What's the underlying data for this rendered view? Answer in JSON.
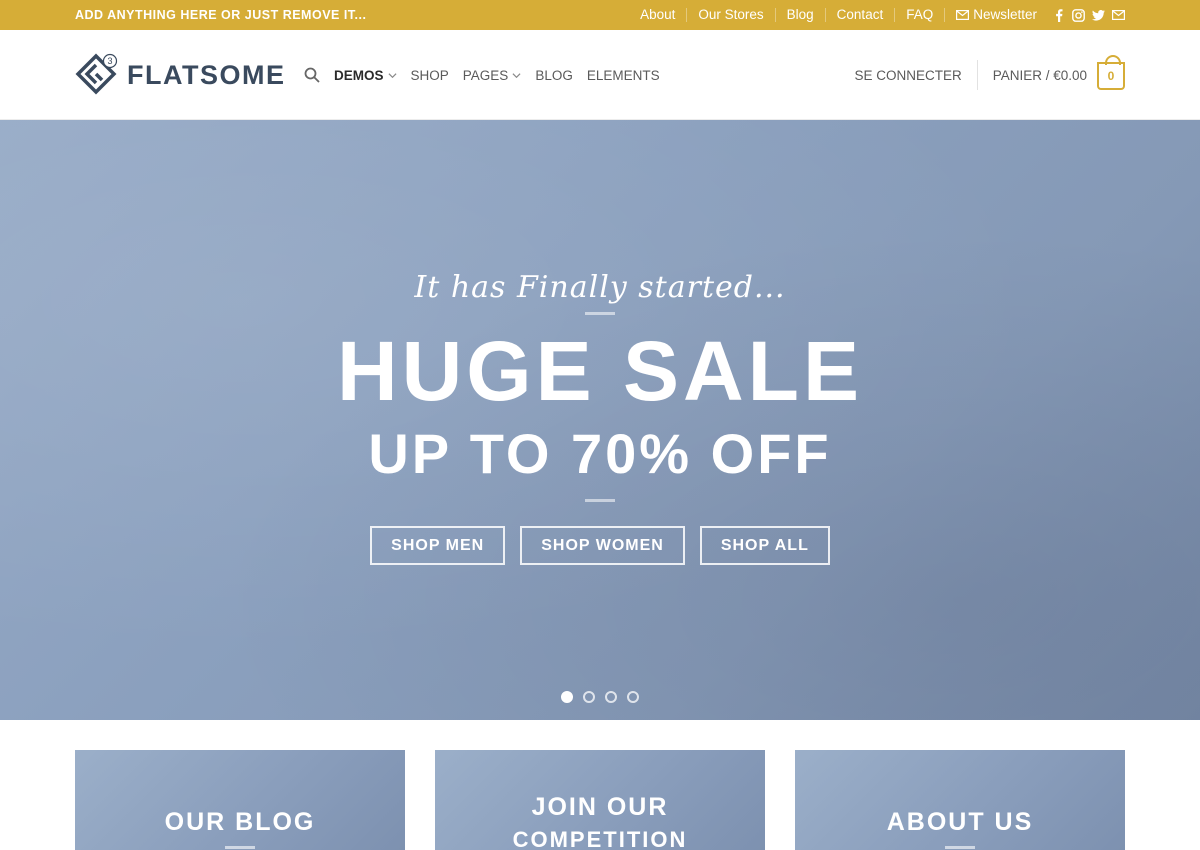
{
  "topbar": {
    "promo": "ADD ANYTHING HERE OR JUST REMOVE IT...",
    "links": [
      {
        "label": "About"
      },
      {
        "label": "Our Stores"
      },
      {
        "label": "Blog"
      },
      {
        "label": "Contact"
      },
      {
        "label": "FAQ"
      },
      {
        "label": "Newsletter",
        "icon": "envelope-icon"
      }
    ],
    "socials": [
      "facebook-icon",
      "instagram-icon",
      "twitter-icon",
      "email-icon"
    ]
  },
  "header": {
    "logo_text": "FLATSOME",
    "logo_badge": "3",
    "nav": [
      {
        "label": "DEMOS",
        "dropdown": true,
        "active": true
      },
      {
        "label": "SHOP",
        "dropdown": false
      },
      {
        "label": "PAGES",
        "dropdown": true
      },
      {
        "label": "BLOG",
        "dropdown": false
      },
      {
        "label": "ELEMENTS",
        "dropdown": false
      }
    ],
    "login": "SE CONNECTER",
    "cart_label": "PANIER / €0.00",
    "cart_count": "0"
  },
  "hero": {
    "kicker": "It has Finally started...",
    "title": "HUGE SALE",
    "subtitle": "UP TO 70% OFF",
    "buttons": [
      "SHOP MEN",
      "SHOP WOMEN",
      "SHOP ALL"
    ],
    "slides": 4,
    "active_slide": 1
  },
  "boxes": [
    {
      "line1": "OUR BLOG"
    },
    {
      "line1": "JOIN OUR",
      "line2": "COMPETITION"
    },
    {
      "line1": "ABOUT US"
    }
  ],
  "colors": {
    "accent": "#d6ad37",
    "hero_bg": "#8a9ebc",
    "logo": "#3a4a5e"
  }
}
